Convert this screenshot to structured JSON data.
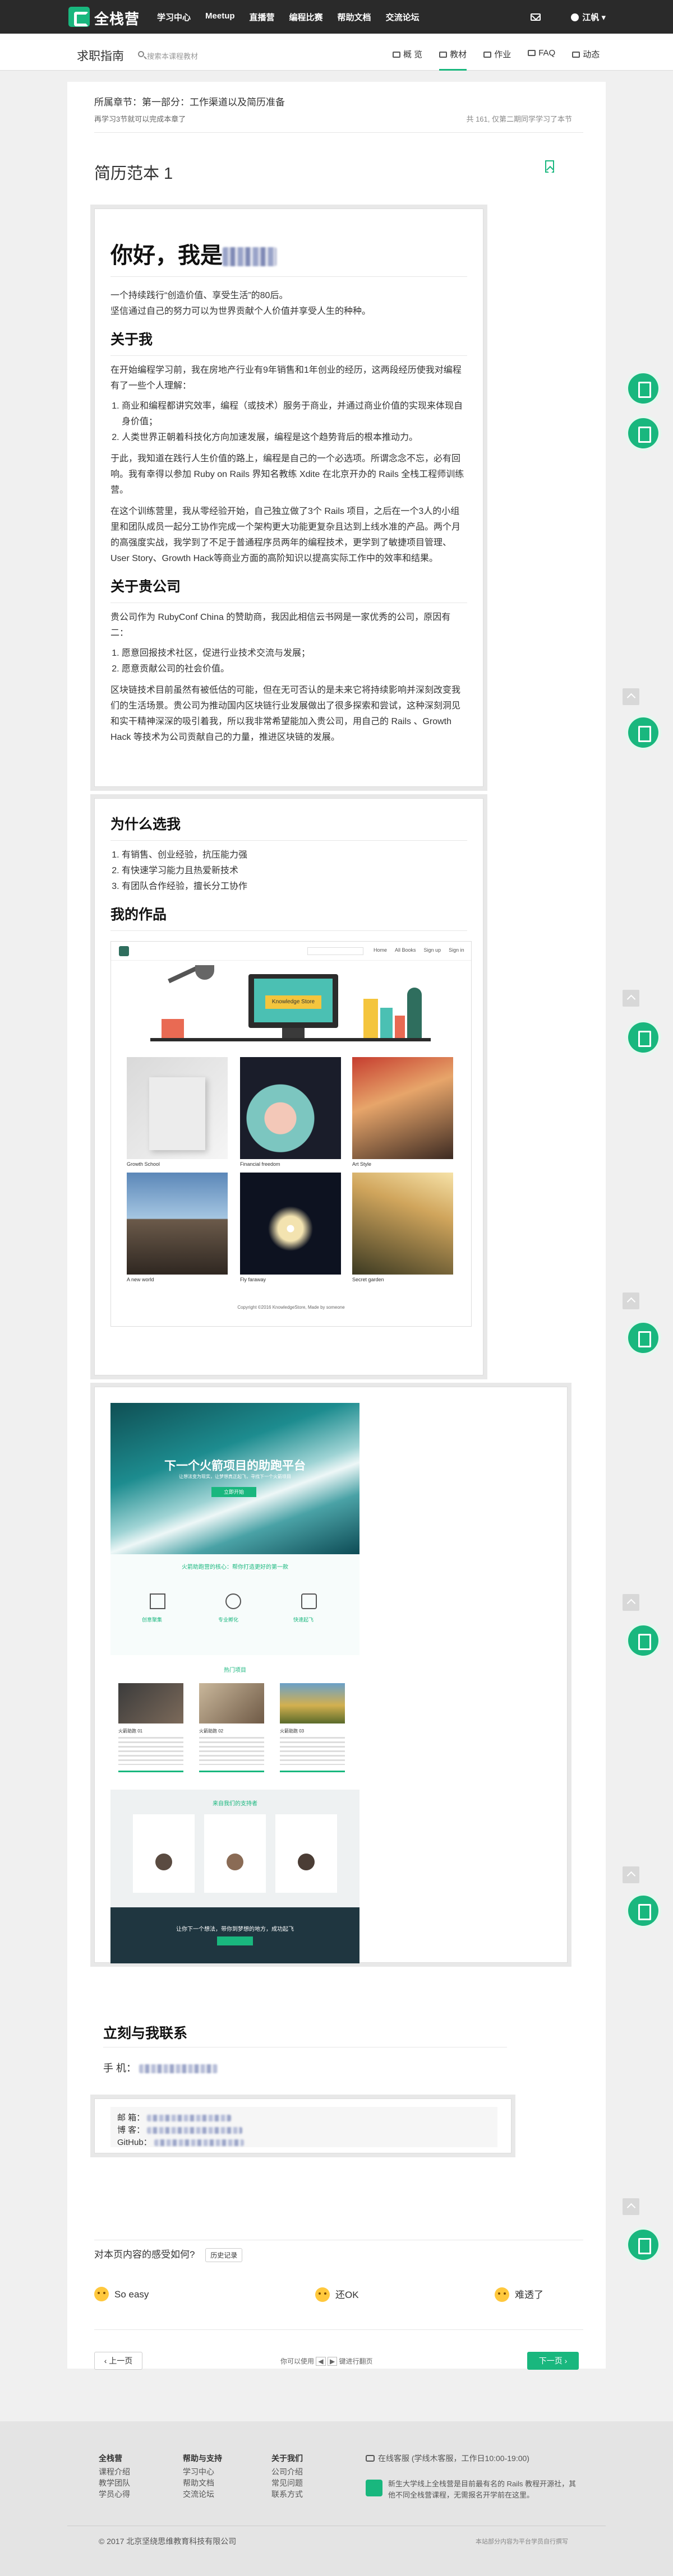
{
  "nav": {
    "brand": "全栈营",
    "items": [
      "学习中心",
      "Meetup",
      "直播营",
      "编程比赛",
      "帮助文档",
      "交流论坛"
    ],
    "user": "江帆"
  },
  "subnav": {
    "title": "求职指南",
    "search_placeholder": "搜索本课程教材",
    "tabs": [
      {
        "label": "概 览",
        "icon": "overview-icon"
      },
      {
        "label": "教材",
        "icon": "book-icon",
        "active": true
      },
      {
        "label": "作业",
        "icon": "homework-icon"
      },
      {
        "label": "FAQ",
        "icon": "faq-icon"
      },
      {
        "label": "动态",
        "icon": "activity-icon"
      }
    ]
  },
  "chapter": {
    "title": "所属章节：第一部分：工作渠道以及简历准备",
    "desc": "再学习3节就可以完成本章了",
    "progress": "共 161, 仅第二期同学学习了本节"
  },
  "page_title": "简历范本 1",
  "resume": {
    "greeting": "你好，我是",
    "intro": [
      "一个持续践行“创造价值、享受生活”的80后。",
      "坚信通过自己的努力可以为世界贡献个人价值并享受人生的种种。"
    ],
    "about_title": "关于我",
    "about_p1": "在开始编程学习前，我在房地产行业有9年销售和1年创业的经历，这两段经历使我对编程有了一些个人理解：",
    "about_list": [
      "商业和编程都讲究效率，编程（或技术）服务于商业，并通过商业价值的实现来体现自身价值；",
      "人类世界正朝着科技化方向加速发展，编程是这个趋势背后的根本推动力。"
    ],
    "about_p2": "于此，我知道在践行人生价值的路上，编程是自己的一个必选项。所谓念念不忘，必有回响。我有幸得以参加 Ruby on Rails 界知名教练 Xdite 在北京开办的 Rails 全栈工程师训练营。",
    "about_p3": "在这个训练营里，我从零经验开始，自己独立做了3个 Rails 项目，之后在一个3人的小组里和团队成员一起分工协作完成一个架构更大功能更复杂且达到上线水准的产品。两个月的高强度实战，我学到了不足于普通程序员两年的编程技术，更学到了敏捷项目管理、User Story、Growth Hack等商业方面的高阶知识以提高实际工作中的效率和结果。",
    "company_title": "关于贵公司",
    "company_p1": "贵公司作为 RubyConf China 的赞助商，我因此相信云书网是一家优秀的公司，原因有二：",
    "company_list": [
      "愿意回报技术社区，促进行业技术交流与发展；",
      "愿意贡献公司的社会价值。"
    ],
    "company_p2": "区块链技术目前虽然有被低估的可能，但在无可否认的是未来它将持续影响并深刻改变我们的生活场景。贵公司为推动国内区块链行业发展做出了很多探索和尝试，这种深刻洞见和实干精神深深的吸引着我，所以我非常希望能加入贵公司，用自己的 Rails 、Growth Hack 等技术为公司贡献自己的力量，推进区块链的发展。",
    "why_title": "为什么选我",
    "why_list": [
      "有销售、创业经验，抗压能力强",
      "有快速学习能力且热爱新技术",
      "有团队合作经验，擅长分工协作"
    ],
    "works_title": "我的作品",
    "contact_title": "立刻与我联系",
    "phone_label": "手 机：",
    "email_label": "邮 箱：",
    "blog_label": "博 客：",
    "github_label": "GitHub："
  },
  "mock1": {
    "header": "Knowledge Store",
    "nav_links": [
      "Home",
      "All Books",
      "Sign up",
      "Sign in"
    ],
    "captions": [
      "Growth School",
      "Financial freedom",
      "Art Style",
      "A new world",
      "Fly faraway",
      "Secret garden"
    ],
    "footer": "Copyright ©2016 KnowledgeStore, Made by someone"
  },
  "mock2": {
    "hero_title": "下一个火箭项目的助跑平台",
    "hero_sub": "让想法变为现实，让梦想真正起飞，寻找下一个火箭项目",
    "hero_btn": "立即开始",
    "section1": "火箭助跑营的核心：帮你打造更好的第一款",
    "features": [
      "创意聚集",
      "专业孵化",
      "快速起飞"
    ],
    "section2": "热门项目",
    "projects": [
      "火箭助跑 01",
      "火箭助跑 02",
      "火箭助跑 03"
    ],
    "section3": "来自我们的支持者",
    "banner": "让你下一个想法，带你到梦想的地方，成功起飞"
  },
  "feedback": {
    "question": "对本页内容的感受如何?",
    "history": "历史记录",
    "options": [
      "So easy",
      "还OK",
      "难透了"
    ]
  },
  "pager": {
    "prev": "上一页",
    "middle": "你可以使用",
    "middle2": "键进行翻页",
    "next": "下一页"
  },
  "footer": {
    "cols": [
      {
        "title": "全栈营",
        "links": [
          "课程介绍",
          "教学团队",
          "学员心得"
        ]
      },
      {
        "title": "帮助与支持",
        "links": [
          "学习中心",
          "帮助文档",
          "交流论坛"
        ]
      },
      {
        "title": "关于我们",
        "links": [
          "公司介绍",
          "常见问题",
          "联系方式"
        ]
      }
    ],
    "service": "在线客服 (学线木客服，工作日10:00-19:00)",
    "slogan": "新生大学线上全栈营是目前最有名的 Rails 教程开源社，其他不同全栈营课程，无需报名开学前在这里。",
    "copyright": "© 2017 北京坚绕思维教育科技有限公司",
    "beian": "本站部分内容为平台学员自行撰写"
  }
}
